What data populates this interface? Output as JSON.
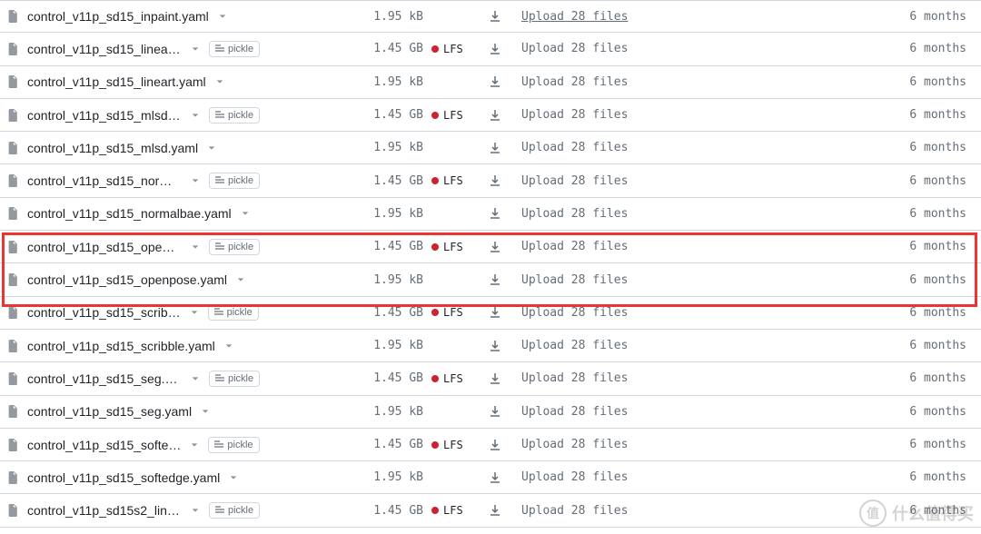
{
  "tags": {
    "pickle": "pickle",
    "lfs": "LFS"
  },
  "files": [
    {
      "name": "control_v11p_sd15_inpaint.yaml",
      "pickle": false,
      "size": "1.95 kB",
      "lfs": false,
      "msg": "Upload 28 files",
      "msg_u": true,
      "time": "6 months"
    },
    {
      "name": "control_v11p_sd15_linear…",
      "pickle": true,
      "size": "1.45 GB",
      "lfs": true,
      "msg": "Upload 28 files",
      "msg_u": false,
      "time": "6 months"
    },
    {
      "name": "control_v11p_sd15_lineart.yaml",
      "pickle": false,
      "size": "1.95 kB",
      "lfs": false,
      "msg": "Upload 28 files",
      "msg_u": false,
      "time": "6 months"
    },
    {
      "name": "control_v11p_sd15_mlsd.…",
      "pickle": true,
      "size": "1.45 GB",
      "lfs": true,
      "msg": "Upload 28 files",
      "msg_u": false,
      "time": "6 months"
    },
    {
      "name": "control_v11p_sd15_mlsd.yaml",
      "pickle": false,
      "size": "1.95 kB",
      "lfs": false,
      "msg": "Upload 28 files",
      "msg_u": false,
      "time": "6 months"
    },
    {
      "name": "control_v11p_sd15_norm…",
      "pickle": true,
      "size": "1.45 GB",
      "lfs": true,
      "msg": "Upload 28 files",
      "msg_u": false,
      "time": "6 months"
    },
    {
      "name": "control_v11p_sd15_normalbae.yaml",
      "pickle": false,
      "size": "1.95 kB",
      "lfs": false,
      "msg": "Upload 28 files",
      "msg_u": false,
      "time": "6 months"
    },
    {
      "name": "control_v11p_sd15_open…",
      "pickle": true,
      "size": "1.45 GB",
      "lfs": true,
      "msg": "Upload 28 files",
      "msg_u": false,
      "time": "6 months"
    },
    {
      "name": "control_v11p_sd15_openpose.yaml",
      "pickle": false,
      "size": "1.95 kB",
      "lfs": false,
      "msg": "Upload 28 files",
      "msg_u": false,
      "time": "6 months"
    },
    {
      "name": "control_v11p_sd15_scrib…",
      "pickle": true,
      "size": "1.45 GB",
      "lfs": true,
      "msg": "Upload 28 files",
      "msg_u": false,
      "time": "6 months"
    },
    {
      "name": "control_v11p_sd15_scribble.yaml",
      "pickle": false,
      "size": "1.95 kB",
      "lfs": false,
      "msg": "Upload 28 files",
      "msg_u": false,
      "time": "6 months"
    },
    {
      "name": "control_v11p_sd15_seg.pth",
      "pickle": true,
      "size": "1.45 GB",
      "lfs": true,
      "msg": "Upload 28 files",
      "msg_u": false,
      "time": "6 months"
    },
    {
      "name": "control_v11p_sd15_seg.yaml",
      "pickle": false,
      "size": "1.95 kB",
      "lfs": false,
      "msg": "Upload 28 files",
      "msg_u": false,
      "time": "6 months"
    },
    {
      "name": "control_v11p_sd15_softe…",
      "pickle": true,
      "size": "1.45 GB",
      "lfs": true,
      "msg": "Upload 28 files",
      "msg_u": false,
      "time": "6 months"
    },
    {
      "name": "control_v11p_sd15_softedge.yaml",
      "pickle": false,
      "size": "1.95 kB",
      "lfs": false,
      "msg": "Upload 28 files",
      "msg_u": false,
      "time": "6 months"
    },
    {
      "name": "control_v11p_sd15s2_line…",
      "pickle": true,
      "size": "1.45 GB",
      "lfs": true,
      "msg": "Upload 28 files",
      "msg_u": false,
      "time": "6 months"
    }
  ],
  "watermark": "什么值得买"
}
